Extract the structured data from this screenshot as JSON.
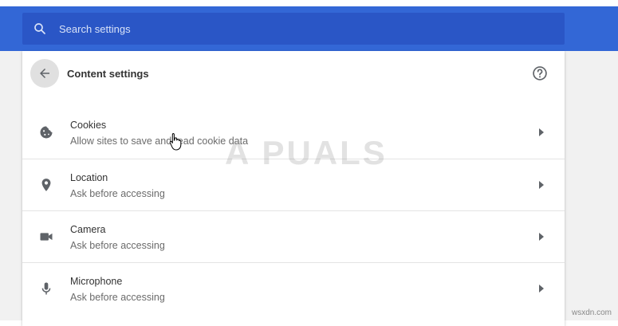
{
  "search": {
    "placeholder": "Search settings"
  },
  "header": {
    "title": "Content settings"
  },
  "rows": [
    {
      "title": "Cookies",
      "subtitle": "Allow sites to save and read cookie data",
      "icon": "cookie-icon"
    },
    {
      "title": "Location",
      "subtitle": "Ask before accessing",
      "icon": "location-pin-icon"
    },
    {
      "title": "Camera",
      "subtitle": "Ask before accessing",
      "icon": "camera-icon"
    },
    {
      "title": "Microphone",
      "subtitle": "Ask before accessing",
      "icon": "microphone-icon"
    }
  ],
  "watermark": "A PUALS",
  "footer_mark": "wsxdn.com",
  "colors": {
    "header_blue": "#3367d6",
    "search_blue": "#2a56c6",
    "icon_gray": "#5f6368"
  }
}
